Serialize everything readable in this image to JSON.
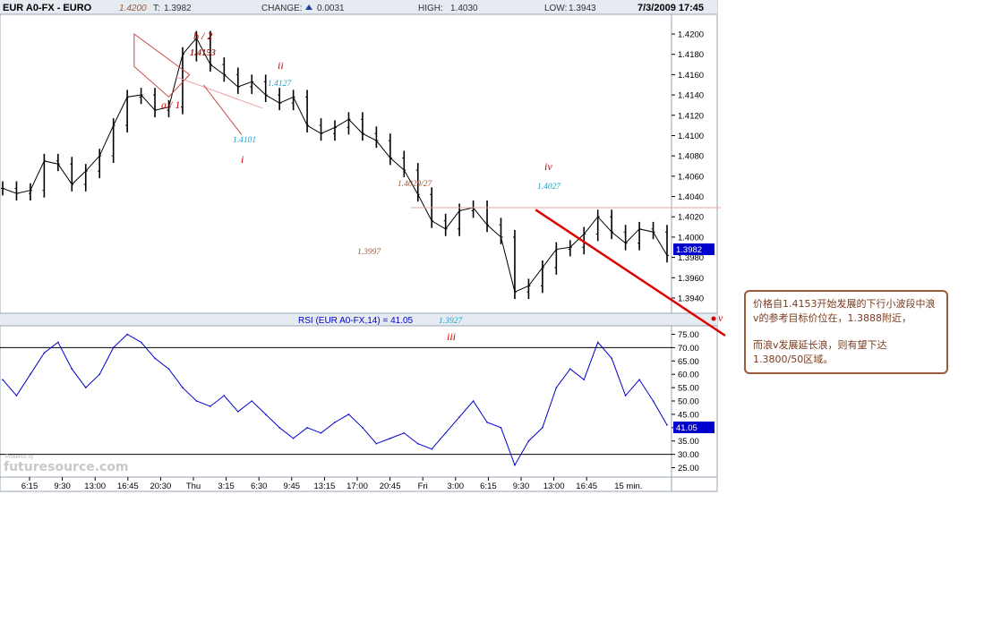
{
  "header": {
    "symbol": "EUR A0-FX - EURO",
    "high_mark": "1.4200",
    "last_label": "T:",
    "last": "1.3982",
    "change_label": "CHANGE:",
    "change": "0.0031",
    "high_label": "HIGH:",
    "high": "1.4030",
    "low_label": "LOW:",
    "low": "1.3943",
    "datetime": "7/3/2009 17:45"
  },
  "colors": {
    "up_arrow": "#1f3f9f",
    "ohlc": "#000000",
    "rsi_line": "#0000cc",
    "wave_label": "#cc0000",
    "level_cyan": "#1aa3c8",
    "level_brown": "#9b5a3c",
    "trend": "#e00000",
    "price_box": "#0000cc"
  },
  "price_tag": "1.3982",
  "rsi_title": "RSI (EUR A0-FX,14) = 41.05",
  "rsi_tag": "41.05",
  "watermark": "futuresource.com",
  "watermark_sub": "Powered by",
  "annotations": {
    "wave_labels": [
      "b / 2",
      "ii",
      "a / 1",
      "i",
      "iv",
      "iii",
      "v"
    ],
    "levels": [
      "1.4153",
      "1.4127",
      "1.4101",
      "1.4029/27",
      "1.3997",
      "1.4027",
      "1.3927"
    ]
  },
  "note": {
    "line1": "价格自1.4153开始发展的下行小波段中浪v的参考目标价位在，1.3888附近，",
    "line2": "而浪v发展延长浪，则有望下达 1.3800/50区域。"
  },
  "chart_data": [
    {
      "type": "line",
      "title": "EUR A0-FX - EURO",
      "interval": "15 min.",
      "price_axis_ticks": [
        "1.4200",
        "1.4180",
        "1.4160",
        "1.4140",
        "1.4120",
        "1.4100",
        "1.4080",
        "1.4060",
        "1.4040",
        "1.4020",
        "1.4000",
        "1.3980",
        "1.3960",
        "1.3940"
      ],
      "time_axis_ticks": [
        "6:15",
        "9:30",
        "13:00",
        "16:45",
        "20:30",
        "Thu",
        "3:15",
        "6:30",
        "9:45",
        "13:15",
        "17:00",
        "20:45",
        "Fri",
        "3:00",
        "6:15",
        "9:30",
        "13:00",
        "16:45",
        "15 min."
      ],
      "ylim": [
        1.3925,
        1.4215
      ],
      "x": [
        0,
        4,
        8,
        12,
        16,
        20,
        24,
        28,
        32,
        36,
        40,
        44,
        48,
        52,
        56,
        60,
        64,
        68,
        72,
        76,
        80,
        84,
        88,
        92,
        96,
        100,
        104,
        108,
        112,
        116,
        120,
        124,
        128,
        132,
        136,
        140,
        144,
        148,
        152,
        156,
        160,
        164,
        168,
        172,
        176,
        180,
        184,
        188,
        192
      ],
      "close": [
        1.4048,
        1.4043,
        1.4046,
        1.4075,
        1.4072,
        1.4052,
        1.4065,
        1.408,
        1.411,
        1.4138,
        1.414,
        1.4125,
        1.4128,
        1.418,
        1.4196,
        1.417,
        1.416,
        1.4148,
        1.4153,
        1.414,
        1.4132,
        1.4138,
        1.411,
        1.4102,
        1.4108,
        1.4116,
        1.4102,
        1.4095,
        1.4078,
        1.4066,
        1.4042,
        1.4016,
        1.4008,
        1.4026,
        1.4029,
        1.4012,
        1.4,
        1.3946,
        1.3952,
        1.397,
        1.3988,
        1.399,
        1.4003,
        1.402,
        1.4005,
        1.3994,
        1.4008,
        1.4005,
        1.3982
      ],
      "series": [
        {
          "values": [
            1.4048,
            1.4043,
            1.4046,
            1.4075,
            1.4072,
            1.4052,
            1.4065,
            1.408,
            1.411,
            1.4138,
            1.414,
            1.4125,
            1.4128,
            1.418,
            1.4196,
            1.417,
            1.416,
            1.4148,
            1.4153,
            1.414,
            1.4132,
            1.4138,
            1.411,
            1.4102,
            1.4108,
            1.4116,
            1.4102,
            1.4095,
            1.4078,
            1.4066,
            1.4042,
            1.4016,
            1.4008,
            1.4026,
            1.4029,
            1.4012,
            1.4,
            1.3946,
            1.3952,
            1.397,
            1.3988,
            1.399,
            1.4003,
            1.402,
            1.4005,
            1.3994,
            1.4008,
            1.4005,
            1.3982
          ]
        }
      ],
      "trend_line": {
        "x": [
          154,
          202
        ],
        "y": [
          1.4027,
          1.388
        ]
      },
      "resistance": 1.4029
    },
    {
      "type": "line",
      "title": "RSI (EUR A0-FX,14) = 41.05",
      "y_axis_ticks": [
        "75.00",
        "70.00",
        "65.00",
        "60.00",
        "55.00",
        "50.00",
        "45.00",
        "40.00",
        "35.00",
        "30.00",
        "25.00"
      ],
      "ylim": [
        22.5,
        77.5
      ],
      "reference_lines": [
        70,
        30
      ],
      "x": [
        0,
        4,
        8,
        12,
        16,
        20,
        24,
        28,
        32,
        36,
        40,
        44,
        48,
        52,
        56,
        60,
        64,
        68,
        72,
        76,
        80,
        84,
        88,
        92,
        96,
        100,
        104,
        108,
        112,
        116,
        120,
        124,
        128,
        132,
        136,
        140,
        144,
        148,
        152,
        156,
        160,
        164,
        168,
        172,
        176,
        180,
        184,
        188,
        192
      ],
      "series": [
        {
          "values": [
            58,
            52,
            60,
            68,
            72,
            62,
            55,
            60,
            70,
            75,
            72,
            66,
            62,
            55,
            50,
            48,
            52,
            46,
            50,
            45,
            40,
            36,
            40,
            38,
            42,
            45,
            40,
            34,
            36,
            38,
            34,
            32,
            38,
            44,
            50,
            42,
            40,
            26,
            35,
            40,
            55,
            62,
            58,
            72,
            66,
            52,
            58,
            50,
            41
          ]
        }
      ]
    }
  ]
}
